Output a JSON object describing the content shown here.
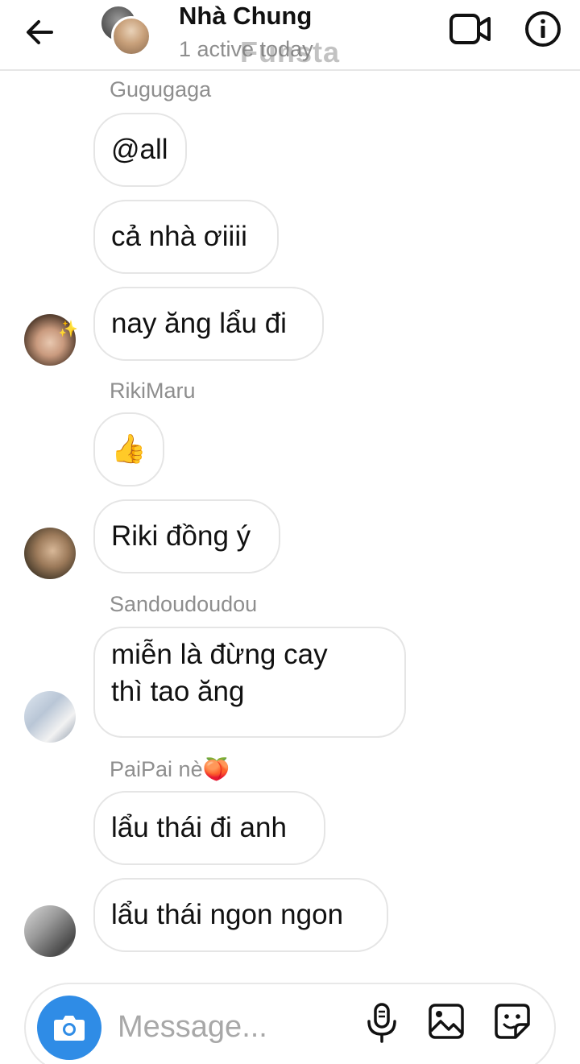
{
  "header": {
    "title": "Nhà Chung",
    "status": "1 active today",
    "watermark": "Funsta",
    "back_icon": "arrow-left-icon",
    "video_icon": "video-camera-icon",
    "info_icon": "info-icon"
  },
  "messages": [
    {
      "sender": "Gugugaga",
      "bubbles": [
        "@all",
        "cả nhà ơiiii",
        "nay ăng lẩu đi"
      ]
    },
    {
      "sender": "RikiMaru",
      "bubbles": [
        "👍",
        "Riki đồng ý"
      ]
    },
    {
      "sender": "Sandoudoudou",
      "bubbles": [
        "miễn là đừng cay\nthì tao ăng"
      ]
    },
    {
      "sender": "PaiPai nè🍑",
      "bubbles": [
        "lẩu thái đi anh",
        "lẩu thái ngon ngon"
      ]
    }
  ],
  "composer": {
    "placeholder": "Message...",
    "camera_icon": "camera-icon",
    "mic_icon": "microphone-icon",
    "gallery_icon": "image-gallery-icon",
    "sticker_icon": "sticker-icon"
  },
  "colors": {
    "accent": "#2f8ce6",
    "bubble_border": "#e5e5e5",
    "secondary_text": "#8e8e8e"
  }
}
